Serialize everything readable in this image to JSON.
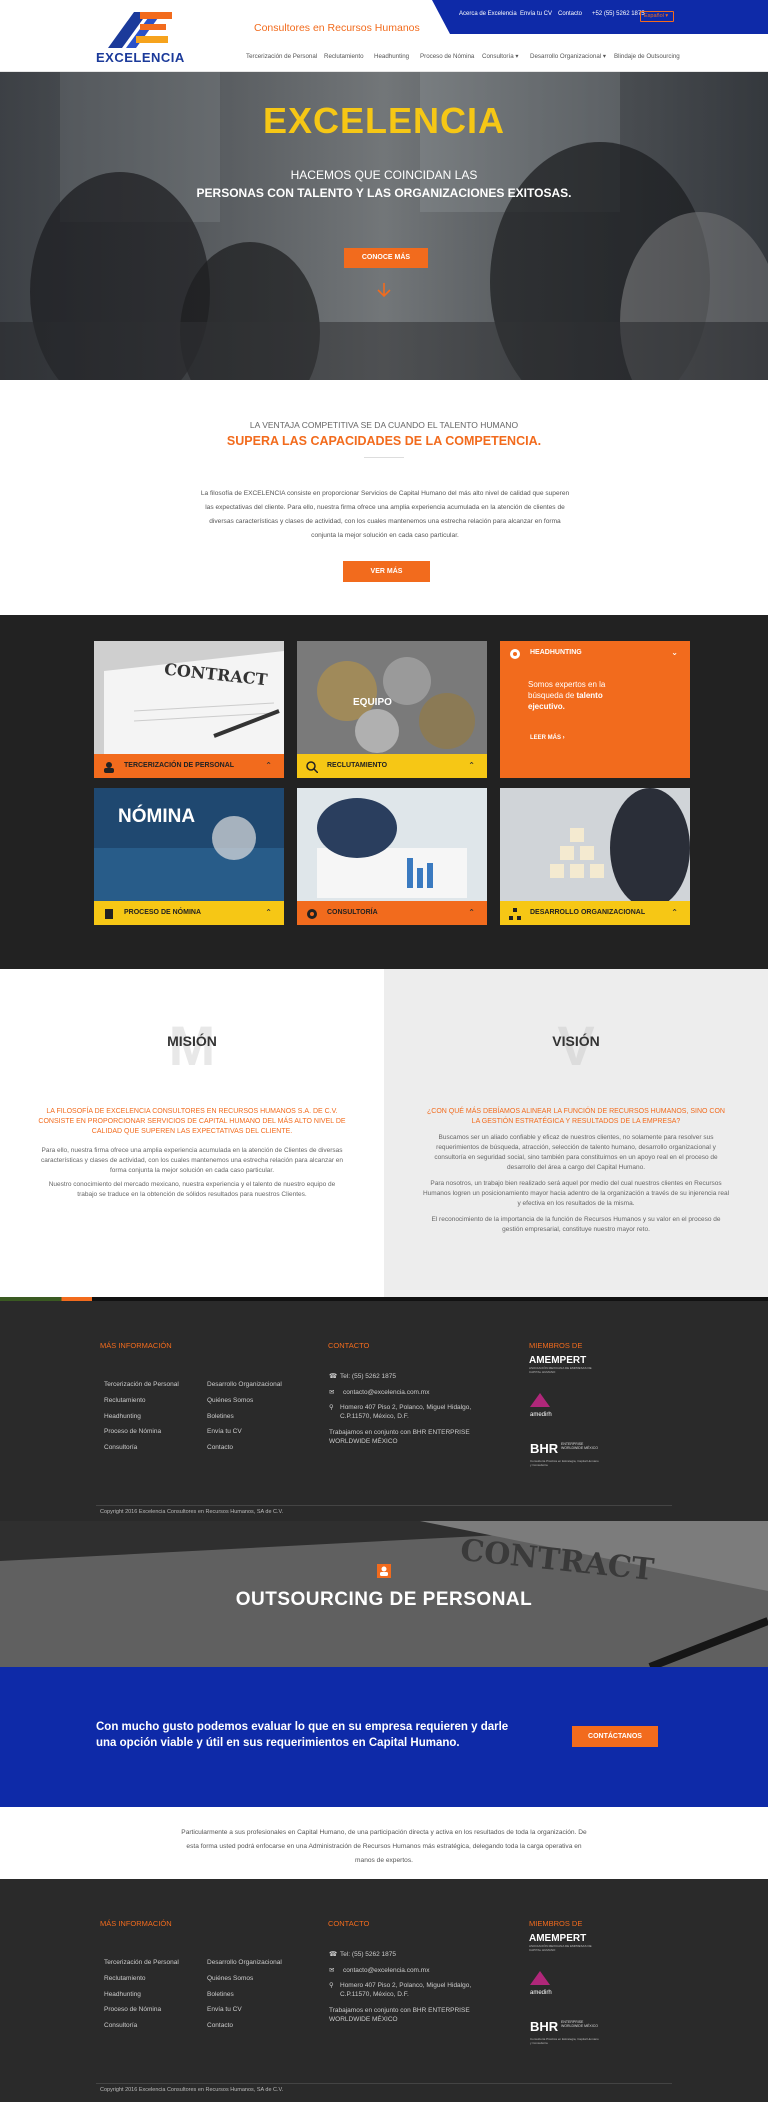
{
  "brand": {
    "name": "EXCELENCIA",
    "tagline": "Consultores en Recursos Humanos",
    "colors": {
      "orange": "#f26b1d",
      "blue": "#0e2aa8",
      "yellow": "#f6c715",
      "dark": "#222222"
    }
  },
  "topbar": {
    "items": [
      "Acerca de Excelencia",
      "Envía tu CV",
      "Contacto",
      "+52 (55) 5262 1875"
    ],
    "language": "Español"
  },
  "nav": [
    "Tercerización de Personal",
    "Reclutamiento",
    "Headhunting",
    "Proceso de Nómina",
    "Consultoría",
    "Desarrollo Organizacional",
    "Blindaje de Outsourcing"
  ],
  "hero": {
    "title": "EXCELENCIA",
    "line1": "HACEMOS QUE COINCIDAN LAS",
    "line2": "PERSONAS CON TALENTO Y LAS ORGANIZACIONES EXITOSAS.",
    "button": "CONOCE MÁS"
  },
  "intro": {
    "pre": "LA VENTAJA COMPETITIVA SE DA CUANDO EL TALENTO HUMANO",
    "headline": "SUPERA LAS CAPACIDADES DE LA COMPETENCIA.",
    "body": "La filosofía de EXCELENCIA consiste en proporcionar Servicios de Capital Humano del más alto nivel de calidad que superen las expectativas del cliente. Para ello, nuestra firma ofrece una amplia experiencia acumulada en la atención de clientes de diversas características y clases de actividad, con los cuales mantenemos una estrecha relación para alcanzar en forma conjunta la mejor solución en cada caso particular.",
    "button": "VER MÁS"
  },
  "services": [
    {
      "label": "TERCERIZACIÓN DE PERSONAL",
      "image_text": "CONTRACT"
    },
    {
      "label": "RECLUTAMIENTO",
      "image_text": "EQUIPO"
    },
    {
      "label": "HEADHUNTING",
      "description_pre": "Somos expertos en la búsqueda de ",
      "description_bold": "talento ejecutivo.",
      "link": "LEER MÁS"
    },
    {
      "label": "PROCESO DE NÓMINA",
      "image_text": "NÓMINA"
    },
    {
      "label": "CONSULTORÍA"
    },
    {
      "label": "DESARROLLO ORGANIZACIONAL"
    }
  ],
  "mision": {
    "letter": "M",
    "title": "MISIÓN",
    "lead": "LA FILOSOFÍA DE EXCELENCIA CONSULTORES EN RECURSOS HUMANOS S.A. DE C.V. CONSISTE EN PROPORCIONAR SERVICIOS DE CAPITAL HUMANO DEL MÁS ALTO NIVEL DE CALIDAD QUE SUPEREN LAS EXPECTATIVAS DEL CLIENTE.",
    "p1": "Para ello, nuestra firma ofrece una amplia experiencia acumulada en la atención de Clientes de diversas características y clases de actividad, con los cuales mantenemos una estrecha relación para alcanzar en forma conjunta la mejor solución en cada caso particular.",
    "p2": "Nuestro conocimiento del mercado mexicano, nuestra experiencia y el talento de nuestro equipo de trabajo se traduce en la obtención de sólidos resultados para nuestros Clientes."
  },
  "vision": {
    "letter": "V",
    "title": "VISIÓN",
    "lead": "¿CON QUÉ MÁS DEBÍAMOS ALINEAR LA FUNCIÓN DE RECURSOS HUMANOS, SINO CON LA GESTIÓN ESTRATÉGICA Y RESULTADOS DE LA EMPRESA?",
    "p1": "Buscamos ser un aliado confiable y eficaz de nuestros clientes, no solamente para resolver sus requerimientos de búsqueda, atracción, selección de talento humano, desarrollo organizacional y consultoría en seguridad social, sino también para constituirnos en un apoyo real en el proceso de desarrollo del área a cargo del Capital Humano.",
    "p2": "Para nosotros, un trabajo bien realizado será aquel por medio del cual nuestros clientes en Recursos Humanos logren un posicionamiento mayor hacia adentro de la organización a través de su injerencia real y efectiva en los resultados de la misma.",
    "p3": "El reconocimiento de la importancia de la función de Recursos Humanos y su valor en el proceso de gestión empresarial, constituye nuestro mayor reto."
  },
  "footer": {
    "more_title": "MÁS INFORMACIÓN",
    "links_col1": [
      "Tercerización de Personal",
      "Reclutamiento",
      "Headhunting",
      "Proceso de Nómina",
      "Consultoría"
    ],
    "links_col2": [
      "Desarrollo Organizacional",
      "Quiénes Somos",
      "Boletines",
      "Envía tu CV",
      "Contacto"
    ],
    "contact_title": "CONTACTO",
    "phone": "Tel: (55) 5262 1875",
    "email": "contacto@excelencia.com.mx",
    "address": "Homero 407 Piso 2, Polanco, Miguel Hidalgo, C.P.11570, México, D.F.",
    "partner": "Trabajamos en conjunto con   BHR ENTERPRISE WORLDWIDE MÉXICO",
    "members_title": "MIEMBROS DE",
    "member1": "AMEMPERT",
    "member1_sub": "ASOCIACIÓN MEXICANA DE EMPRESAS DE CAPITAL HUMANO",
    "member2": "amedirh",
    "member3": "BHR",
    "member3_name": "ENTERPRISE WORLDWIDE MÉXICO",
    "member3_sub": "Consultoría Práctica en Estrategia, Capital Humano y Consultoría",
    "copyright": "Copyright 2016 Excelencia Consultores en Recursos Humanos, SA de C.V."
  },
  "outsourcing": {
    "title": "OUTSOURCING DE PERSONAL",
    "image_text": "CONTRACT"
  },
  "cta": {
    "text": "Con mucho gusto podemos evaluar lo que en su empresa requieren y darle una opción viable y útil en sus requerimientos en Capital Humano.",
    "button": "CONTÁCTANOS"
  },
  "paragraph": {
    "text": "Particularmente a sus profesionales en Capital Humano, de una participación directa y activa en los resultados de toda la organización. De esta forma usted podrá enfocarse en una Administración de Recursos Humanos más estratégica, delegando toda la carga operativa en manos de expertos."
  }
}
